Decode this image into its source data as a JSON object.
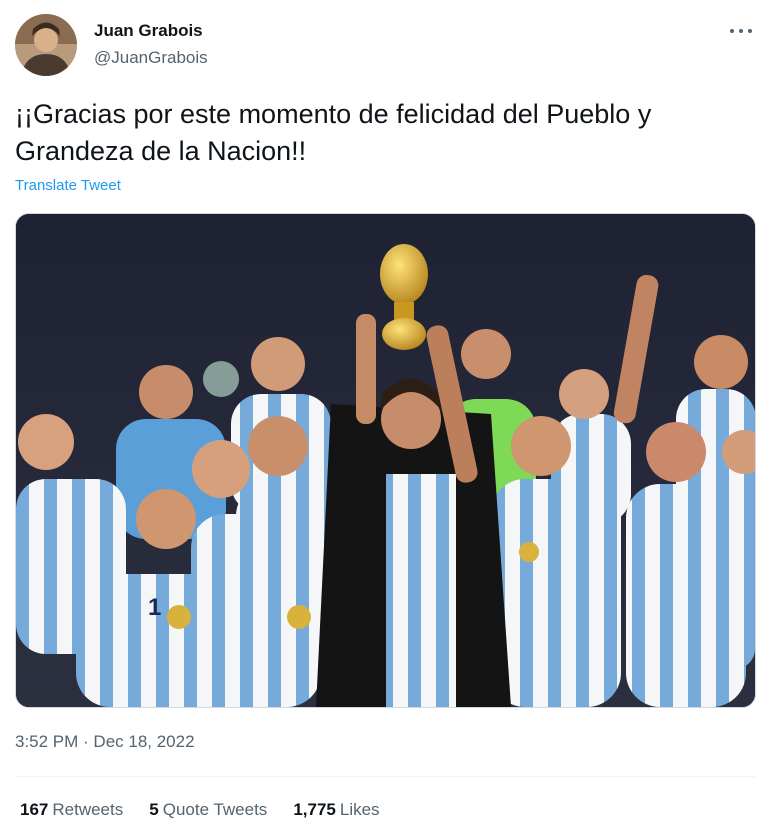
{
  "user": {
    "name": "Juan Grabois",
    "handle": "@JuanGrabois"
  },
  "tweet": {
    "text": "¡¡Gracias por este momento de felicidad del Pueblo y Grandeza de la Nacion!!",
    "translate_label": "Translate Tweet",
    "timestamp": "3:52 PM · Dec 18, 2022"
  },
  "stats": [
    {
      "count": "167",
      "label": "Retweets"
    },
    {
      "count": "5",
      "label": "Quote Tweets"
    },
    {
      "count": "1,775",
      "label": "Likes"
    }
  ],
  "jersey_number": "1",
  "colors": {
    "link": "#1d9bf0",
    "secondary_text": "#536471",
    "jersey_blue": "#75aadb"
  }
}
